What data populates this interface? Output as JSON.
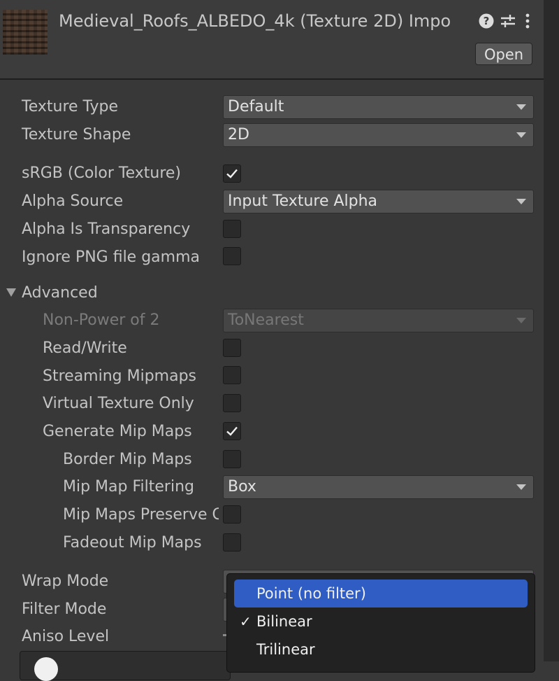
{
  "header": {
    "title": "Medieval_Roofs_ALBEDO_4k (Texture 2D) Impo",
    "open_label": "Open",
    "icons": [
      "help-icon",
      "preset-sliders-icon",
      "kebab-menu-icon"
    ]
  },
  "fields": {
    "texture_type": {
      "label": "Texture Type",
      "value": "Default"
    },
    "texture_shape": {
      "label": "Texture Shape",
      "value": "2D"
    },
    "srgb": {
      "label": "sRGB (Color Texture)",
      "checked": true
    },
    "alpha_source": {
      "label": "Alpha Source",
      "value": "Input Texture Alpha"
    },
    "alpha_transparency": {
      "label": "Alpha Is Transparency",
      "checked": false
    },
    "ignore_png_gamma": {
      "label": "Ignore PNG file gamma",
      "checked": false
    }
  },
  "advanced": {
    "label": "Advanced",
    "expanded": true,
    "non_power_of_2": {
      "label": "Non-Power of 2",
      "value": "ToNearest",
      "disabled": true
    },
    "read_write": {
      "label": "Read/Write",
      "checked": false
    },
    "streaming_mipmaps": {
      "label": "Streaming Mipmaps",
      "checked": false
    },
    "virtual_texture_only": {
      "label": "Virtual Texture Only",
      "checked": false
    },
    "generate_mip_maps": {
      "label": "Generate Mip Maps",
      "checked": true
    },
    "border_mip_maps": {
      "label": "Border Mip Maps",
      "checked": false
    },
    "mip_map_filtering": {
      "label": "Mip Map Filtering",
      "value": "Box"
    },
    "mip_maps_preserve": {
      "label": "Mip Maps Preserve Coverage",
      "checked": false
    },
    "fadeout_mip_maps": {
      "label": "Fadeout Mip Maps",
      "checked": false
    }
  },
  "wrap_mode": {
    "label": "Wrap Mode"
  },
  "filter_mode": {
    "label": "Filter Mode",
    "options": [
      {
        "label": "Point (no filter)",
        "highlighted": true,
        "checked": false
      },
      {
        "label": "Bilinear",
        "highlighted": false,
        "checked": true
      },
      {
        "label": "Trilinear",
        "highlighted": false,
        "checked": false
      }
    ],
    "check_glyph": "✓"
  },
  "aniso_level": {
    "label": "Aniso Level"
  },
  "colors": {
    "background": "#383838",
    "highlight": "#2f5dc3",
    "text": "#c4c4c4"
  }
}
